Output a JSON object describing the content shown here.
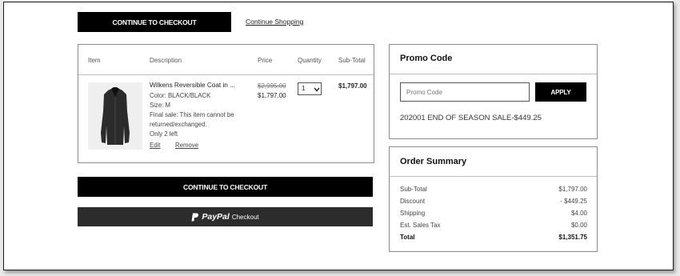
{
  "actions": {
    "continue_checkout_top": "CONTINUE TO CHECKOUT",
    "continue_shopping": "Continue Shopping",
    "continue_checkout_main": "CONTINUE TO CHECKOUT",
    "paypal_brand": "PayPal",
    "paypal_label": "Checkout"
  },
  "cart": {
    "headers": {
      "item": "Item",
      "description": "Description",
      "price": "Price",
      "quantity": "Quantity",
      "subtotal": "Sub-Total"
    },
    "item": {
      "name": "Wilkens Reversible Coat in ...",
      "color": "Color: BLACK/BLACK",
      "size": "Size: M",
      "final_sale_1": "Final sale: This item cannot be",
      "final_sale_2": "returned/exchanged.",
      "stock": "Only 2 left",
      "edit": "Edit",
      "remove": "Remove",
      "original_price": "$2,995.00",
      "price": "$1,797.00",
      "quantity": "1",
      "subtotal": "$1,797.00"
    }
  },
  "promo": {
    "title": "Promo Code",
    "placeholder": "Promo Code",
    "apply": "APPLY",
    "applied": "202001 END OF SEASON SALE-$449.25"
  },
  "summary": {
    "title": "Order Summary",
    "rows": [
      {
        "label": "Sub-Total",
        "value": "$1,797.00"
      },
      {
        "label": "Discount",
        "value": "- $449.25"
      },
      {
        "label": "Shipping",
        "value": "$4.00"
      },
      {
        "label": "Est. Sales Tax",
        "value": "$0.00"
      }
    ],
    "total_label": "Total",
    "total_value": "$1,351.75"
  }
}
